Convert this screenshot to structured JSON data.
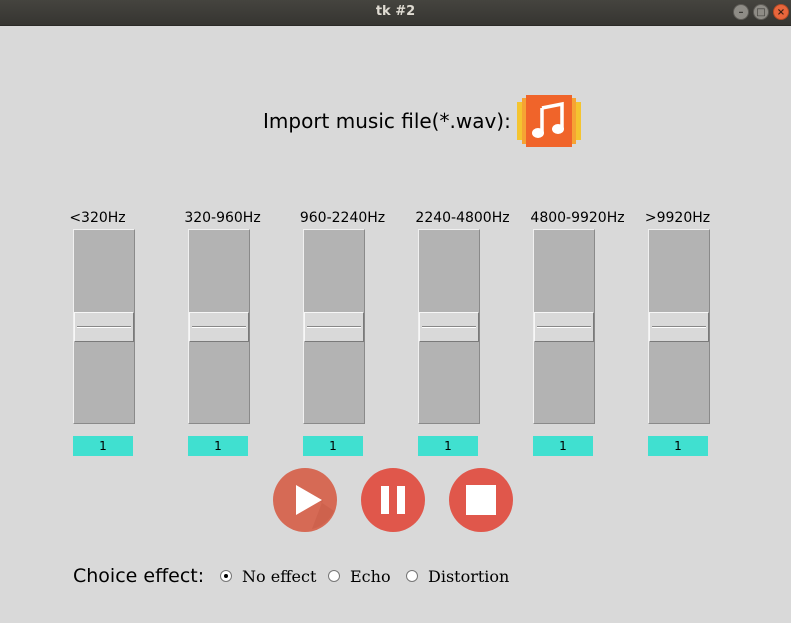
{
  "window": {
    "title": "tk #2",
    "controls": [
      "minimize",
      "maximize",
      "close"
    ]
  },
  "import": {
    "label": "Import music file(*.wav):",
    "icon": "music-file-icon"
  },
  "bands": [
    {
      "label": "<320Hz",
      "value": "1"
    },
    {
      "label": "320-960Hz",
      "value": "1"
    },
    {
      "label": "960-2240Hz",
      "value": "1"
    },
    {
      "label": "2240-4800Hz",
      "value": "1"
    },
    {
      "label": "4800-9920Hz",
      "value": "1"
    },
    {
      "label": ">9920Hz",
      "value": "1"
    }
  ],
  "transport": {
    "buttons": [
      "play-icon",
      "pause-icon",
      "stop-icon"
    ]
  },
  "effects": {
    "label": "Choice effect:",
    "options": [
      {
        "label": "No effect",
        "selected": true
      },
      {
        "label": "Echo",
        "selected": false
      },
      {
        "label": "Distortion",
        "selected": false
      }
    ]
  },
  "colors": {
    "value_box": "#40e0d0",
    "button": "#e0574b",
    "icon_orange": "#f0642a",
    "icon_yellow": "#f4c430"
  }
}
